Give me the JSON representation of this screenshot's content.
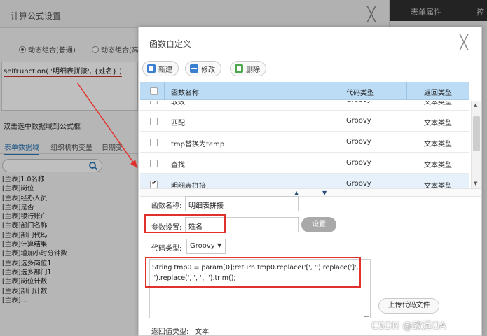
{
  "background_dialog": {
    "title": "计算公式设置",
    "close": "╳",
    "radio_options": [
      {
        "label": "动态组合(普通)",
        "selected": true
      },
      {
        "label": "动态组合(高",
        "selected": false
      }
    ],
    "formula": "selfFunction( '明细表拼接', {姓名} )",
    "hint": "双击选中数据域到公式框",
    "tabs": [
      "表单数据域",
      "组织机构变量",
      "日期变"
    ],
    "field_list": [
      "[主表]1.0名称",
      "[主表]岗位",
      "[主表]经办人员",
      "[主表]是否",
      "[主表]银行账户",
      "[主表]部门名称",
      "[主表]部门代码",
      "[主表]计算结果",
      "[主表]增加小时分钟数",
      "[主表]选多岗位1",
      "[主表]选多部门1",
      "[主表]岗位计数",
      "[主表]部门计数",
      "[主表]…"
    ],
    "right_panel_tabs": [
      "表单属性",
      "控"
    ]
  },
  "function_dialog": {
    "title": "函数自定义",
    "close": "╳",
    "toolbar": {
      "new_label": "新建",
      "edit_label": "修改",
      "delete_label": "删除"
    },
    "table": {
      "headers": {
        "name": "函数名称",
        "code_type": "代码类型",
        "return_type": "返回类型"
      },
      "rows": [
        {
          "name": "取数",
          "code_type": "Groovy",
          "return_type": "文本类型",
          "checked": false,
          "selected": false
        },
        {
          "name": "匹配",
          "code_type": "Groovy",
          "return_type": "文本类型",
          "checked": false,
          "selected": false
        },
        {
          "name": "tmp替换为temp",
          "code_type": "Groovy",
          "return_type": "文本类型",
          "checked": false,
          "selected": false
        },
        {
          "name": "查找",
          "code_type": "Groovy",
          "return_type": "文本类型",
          "checked": false,
          "selected": false
        },
        {
          "name": "明细表拼接",
          "code_type": "Groovy",
          "return_type": "文本类型",
          "checked": true,
          "selected": true
        }
      ]
    },
    "form": {
      "function_name_label": "函数名称:",
      "function_name_value": "明细表拼接",
      "param_label": "参数设置:",
      "param_value": "姓名",
      "set_button": "设置",
      "code_type_label": "代码类型:",
      "code_type_value": "Groovy",
      "code": "String tmp0 = param[0];return  tmp0.replace('[', '').replace(']', '').replace(', ', '、').trim();",
      "upload_button": "上传代码文件",
      "return_type_label": "返回值类型:",
      "return_type_value": "文本"
    }
  },
  "watermark": "CSDN @致远OA",
  "colors": {
    "header_blue": "#bcdcf5",
    "selected_row": "#e6f1fb",
    "annotation_red": "#e2302b",
    "tab_blue": "#2a74b5"
  }
}
